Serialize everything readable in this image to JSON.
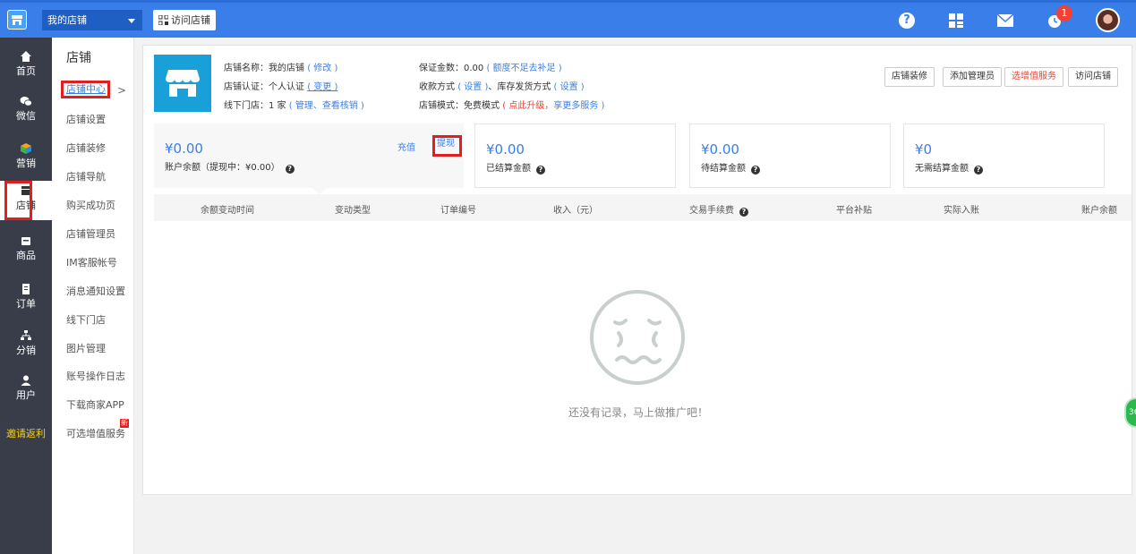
{
  "topbar": {
    "store_select": "我的店铺",
    "visit_button": "访问店铺",
    "notification_count": "1",
    "help_symbol": "?"
  },
  "leftnav": {
    "items": [
      {
        "label": "首页"
      },
      {
        "label": "微信"
      },
      {
        "label": "营销"
      },
      {
        "label": "店铺"
      },
      {
        "label": "商品"
      },
      {
        "label": "订单"
      },
      {
        "label": "分销"
      },
      {
        "label": "用户"
      }
    ],
    "invite": "邀请返利"
  },
  "submenu": {
    "title": "店铺",
    "items": [
      {
        "label": "店铺中心"
      },
      {
        "label": "店铺设置"
      },
      {
        "label": "店铺装修"
      },
      {
        "label": "店铺导航"
      },
      {
        "label": "购买成功页"
      },
      {
        "label": "店铺管理员"
      },
      {
        "label": "IM客服帐号"
      },
      {
        "label": "消息通知设置"
      },
      {
        "label": "线下门店"
      },
      {
        "label": "图片管理"
      },
      {
        "label": "账号操作日志"
      },
      {
        "label": "下载商家APP"
      },
      {
        "label": "可选增值服务"
      }
    ],
    "new_tag": "新",
    "arrow": ">"
  },
  "shop": {
    "name_label": "店铺名称：我的店铺",
    "name_edit": "( 修改 )",
    "cert_label": "店铺认证：个人认证",
    "cert_change": "( 变更 )",
    "offline_label": "线下门店：1 家",
    "offline_links": "( 管理、查看核销 )",
    "deposit_label": "保证金数：0.00",
    "deposit_link": "( 额度不足去补足 )",
    "payment_label": "收款方式",
    "payment_link": "( 设置 )",
    "stock_label": "、库存发货方式",
    "stock_link": "( 设置 )",
    "mode_label": "店铺模式：免费模式",
    "mode_upgrade": "( 点此升级，",
    "mode_more": "享更多服务 )"
  },
  "actions": {
    "decorate": "店铺装修",
    "add_admin": "添加管理员",
    "value_added": "选增值服务",
    "visit": "访问店铺"
  },
  "stats": {
    "balance": {
      "amount": "¥0.00",
      "label": "账户余额（提现中：¥0.00）"
    },
    "recharge": "充值",
    "withdraw": "提现",
    "settled": {
      "amount": "¥0.00",
      "label": "已结算金额"
    },
    "pending": {
      "amount": "¥0.00",
      "label": "待结算金额"
    },
    "no_settle": {
      "amount": "¥0",
      "label": "无需结算金额"
    },
    "q": "?"
  },
  "table": {
    "columns": [
      "余额变动时间",
      "变动类型",
      "订单编号",
      "收入（元）",
      "交易手续费",
      "平台补贴",
      "实际入账",
      "账户余额"
    ]
  },
  "empty": {
    "message": "还没有记录，马上做推广吧！"
  },
  "float_ball": "36"
}
